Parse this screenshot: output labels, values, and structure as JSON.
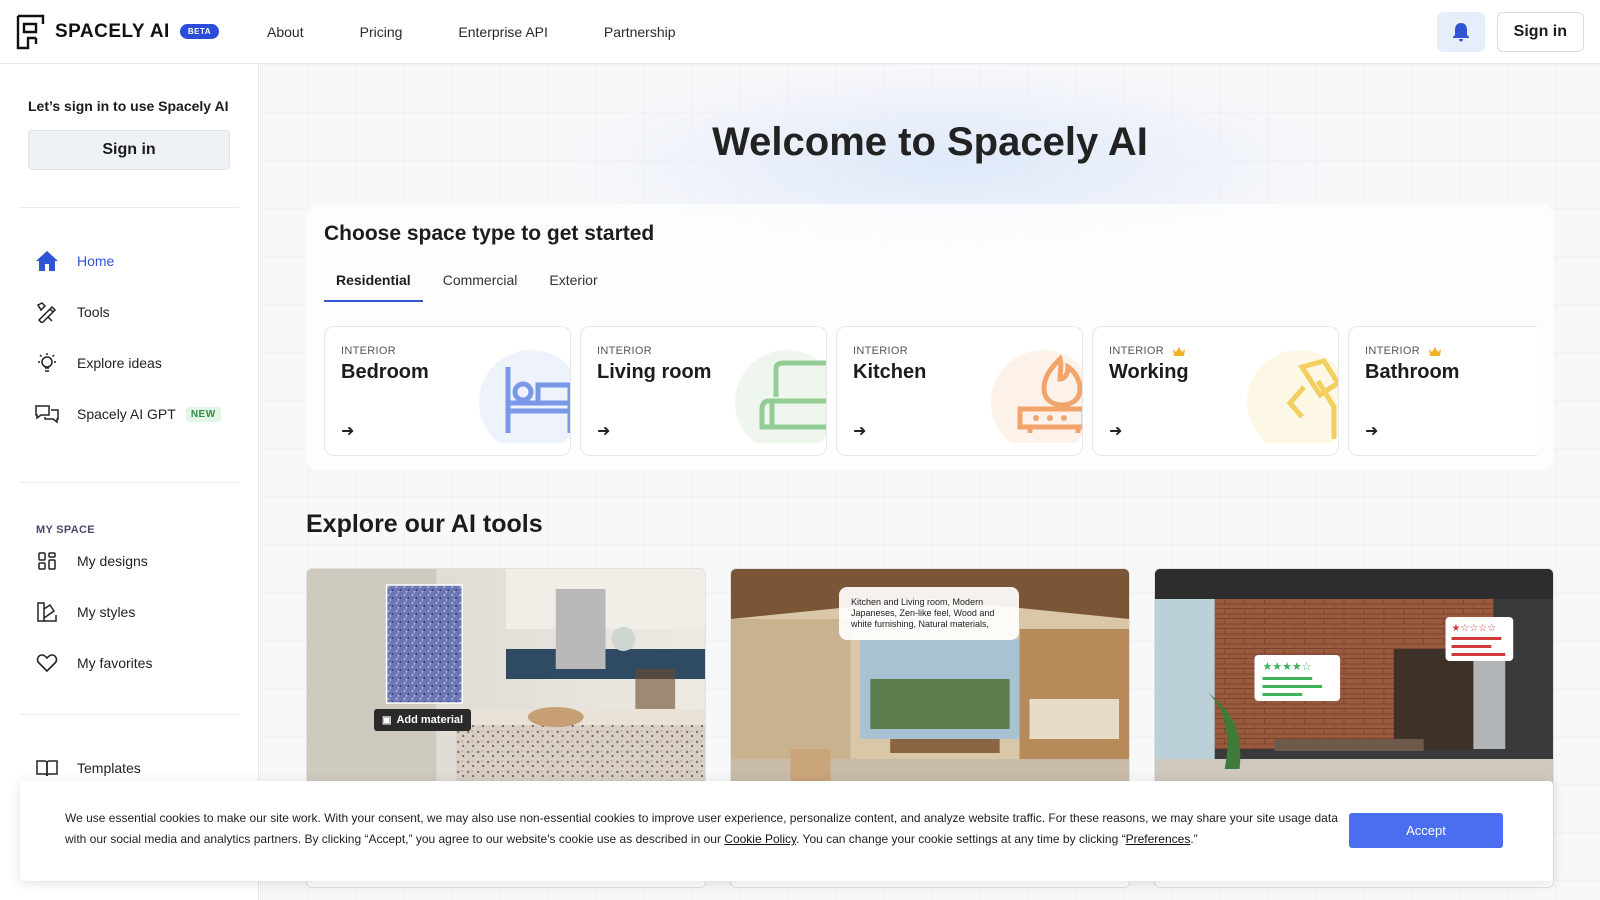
{
  "brand": {
    "name": "SPACELY AI",
    "beta": "BETA"
  },
  "nav": {
    "links": [
      "About",
      "Pricing",
      "Enterprise API",
      "Partnership"
    ],
    "signin": "Sign in"
  },
  "sidebar": {
    "prompt": "Let’s sign in to use Spacely AI",
    "signin": "Sign in",
    "items": [
      {
        "label": "Home",
        "icon": "home-icon",
        "active": true
      },
      {
        "label": "Tools",
        "icon": "tools-icon"
      },
      {
        "label": "Explore ideas",
        "icon": "lightbulb-icon"
      },
      {
        "label": "Spacely AI GPT",
        "icon": "chat-icon",
        "badge": "NEW"
      }
    ],
    "section": "MY SPACE",
    "my_items": [
      {
        "label": "My designs",
        "icon": "grid-icon"
      },
      {
        "label": "My styles",
        "icon": "styles-icon"
      },
      {
        "label": "My favorites",
        "icon": "heart-icon"
      },
      {
        "label": "Templates",
        "icon": "book-icon"
      }
    ]
  },
  "main": {
    "welcome": "Welcome to Spacely AI",
    "space_title": "Choose space type to get started",
    "tabs": [
      "Residential",
      "Commercial",
      "Exterior"
    ],
    "rooms": [
      {
        "category": "INTERIOR",
        "name": "Bedroom",
        "icon": "bed-icon",
        "color": "#6f8ee8",
        "premium": false
      },
      {
        "category": "INTERIOR",
        "name": "Living room",
        "icon": "sofa-icon",
        "color": "#8cc98f",
        "premium": false
      },
      {
        "category": "INTERIOR",
        "name": "Kitchen",
        "icon": "stove-icon",
        "color": "#f2a46a",
        "premium": false
      },
      {
        "category": "INTERIOR",
        "name": "Working",
        "icon": "lamp-icon",
        "color": "#f2cf5e",
        "premium": true
      },
      {
        "category": "INTERIOR",
        "name": "Bathroom",
        "icon": "bath-icon",
        "color": "#8fb3ef",
        "premium": true
      }
    ],
    "tools_title": "Explore our AI tools",
    "tools": [
      {
        "overlay": "Add material"
      },
      {
        "overlay": "Kitchen and Living room, Modern Japaneses, Zen-like feel, Wood and white furnishing, Natural materials,"
      },
      {
        "overlay": ""
      }
    ]
  },
  "cookie": {
    "text_1": "We use essential cookies to make our site work. With your consent, we may also use non-essential cookies to improve user experience, personalize content, and analyze website traffic. For these reasons, we may share your site usage data with our social media and analytics partners. By clicking “Accept,” you agree to our website's cookie use as described in our ",
    "link_1": "Cookie Policy",
    "text_2": ". You can change your cookie settings at any time by clicking “",
    "link_2": "Preferences",
    "text_3": ".”",
    "accept": "Accept"
  },
  "colors": {
    "accent": "#2f55d4",
    "button": "#4b6ef0",
    "beta": "#2b4bd9"
  }
}
